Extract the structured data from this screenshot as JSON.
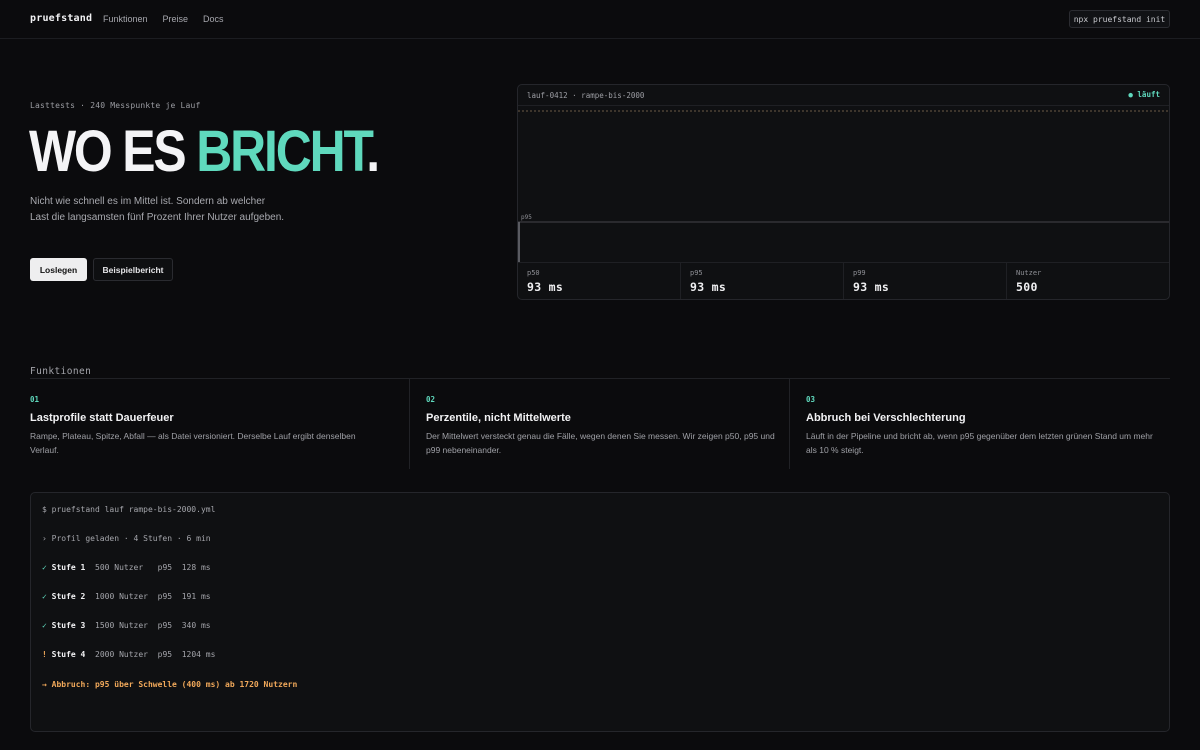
{
  "nav": {
    "brand": "pruefstand",
    "links": [
      "Funktionen",
      "Preise",
      "Docs"
    ],
    "command": "npx pruefstand init"
  },
  "hero": {
    "eyebrow": "Lasttests · 240 Messpunkte je Lauf",
    "headline_main": "WO ES ",
    "headline_accent": "BRICHT",
    "headline_end": ".",
    "lede": "Nicht wie schnell es im Mittel ist. Sondern ab welcher Last die langsamsten fünf Prozent Ihrer Nutzer aufgeben.",
    "primary_button": "Loslegen",
    "secondary_button": "Beispielbericht"
  },
  "monitor": {
    "run_label": "lauf-0412 · rampe-bis-2000",
    "status": "● läuft",
    "chart_label": "p95",
    "stats": [
      {
        "label": "p50",
        "value": "93 ms"
      },
      {
        "label": "p95",
        "value": "93 ms"
      },
      {
        "label": "p99",
        "value": "93 ms"
      },
      {
        "label": "Nutzer",
        "value": "500"
      }
    ]
  },
  "features": {
    "title": "Funktionen",
    "items": [
      {
        "num": "01",
        "title": "Lastprofile statt Dauerfeuer",
        "desc": "Rampe, Plateau, Spitze, Abfall — als Datei versioniert. Derselbe Lauf ergibt denselben Verlauf."
      },
      {
        "num": "02",
        "title": "Perzentile, nicht Mittelwerte",
        "desc": "Der Mittelwert versteckt genau die Fälle, wegen denen Sie messen. Wir zeigen p50, p95 und p99 nebeneinander."
      },
      {
        "num": "03",
        "title": "Abbruch bei Verschlechterung",
        "desc": "Läuft in der Pipeline und bricht ab, wenn p95 gegenüber dem letzten grünen Stand um mehr als 10 % steigt."
      }
    ]
  },
  "terminal": {
    "command": "$ pruefstand lauf rampe-bis-2000.yml",
    "profile": "› Profil geladen · 4 Stufen · 6 min",
    "stages": [
      {
        "mark": "✓",
        "name": "Stufe 1",
        "detail": "  500 Nutzer   p95  128 ms"
      },
      {
        "mark": "✓",
        "name": "Stufe 2",
        "detail": "  1000 Nutzer  p95  191 ms"
      },
      {
        "mark": "✓",
        "name": "Stufe 3",
        "detail": "  1500 Nutzer  p95  340 ms"
      },
      {
        "mark": "!",
        "name": "Stufe 4",
        "detail": "  2000 Nutzer  p95  1204 ms"
      }
    ],
    "abort": "→ Abbruch: p95 über Schwelle (400 ms) ab 1720 Nutzern"
  },
  "colors": {
    "accent": "#5fd9bd",
    "warning": "#f0a85a",
    "background": "#0b0b0d"
  }
}
